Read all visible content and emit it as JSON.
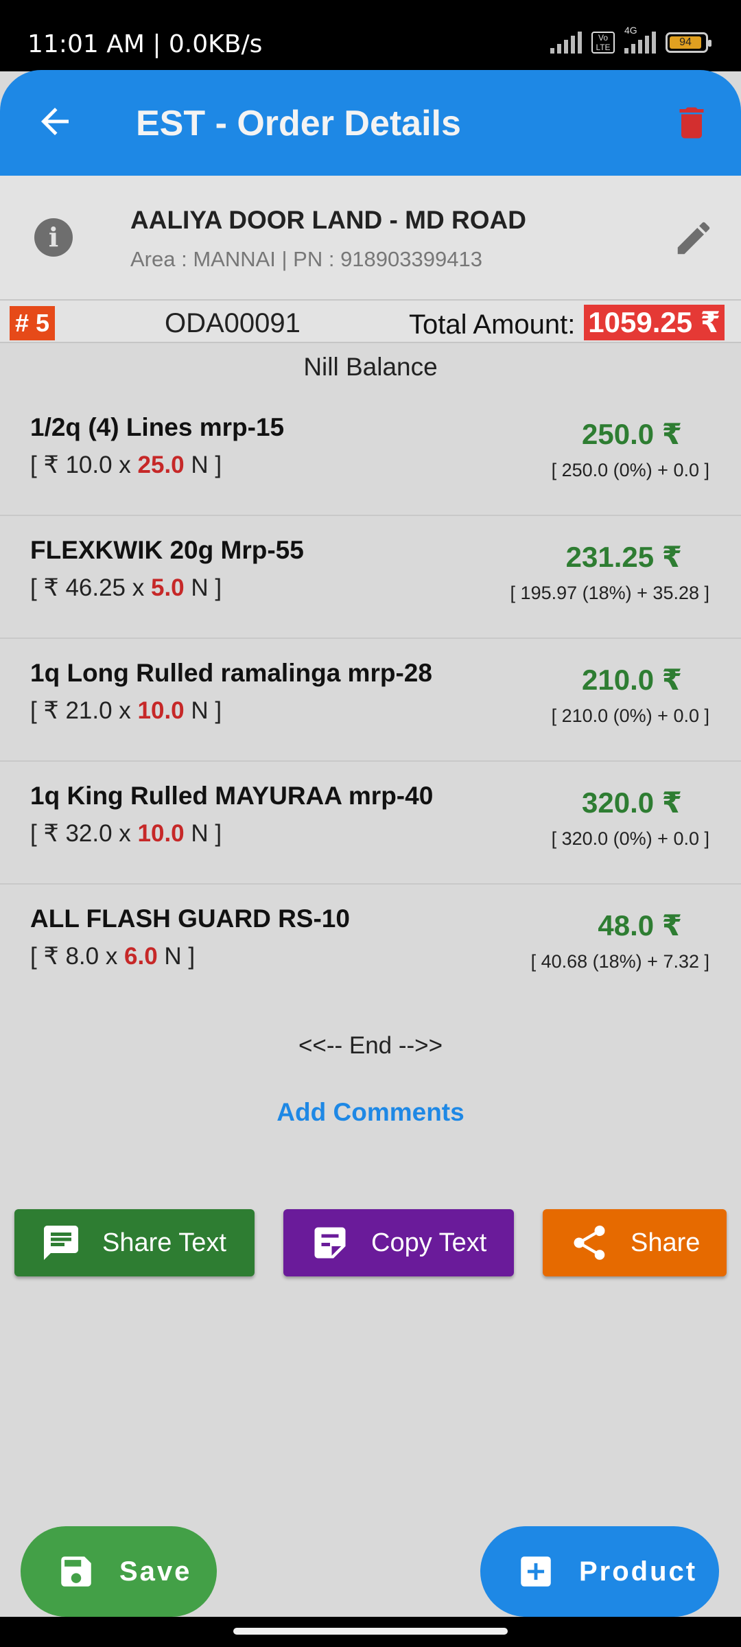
{
  "status_bar": {
    "time": "11:01 AM | 0.0KB/s",
    "network_label": "4G",
    "volte_label": "Vo LTE",
    "battery": "94"
  },
  "app_bar": {
    "title": "EST - Order Details",
    "back_icon": "arrow-left-icon",
    "delete_icon": "trash-icon",
    "color": "#1e88e5"
  },
  "customer": {
    "name": "AALIYA DOOR LAND - MD ROAD",
    "details": "Area : MANNAI | PN : 918903399413",
    "info_icon": "info-icon",
    "edit_icon": "pencil-icon"
  },
  "order": {
    "number": "# 5",
    "id": "ODA00091",
    "total_label": "Total Amount:",
    "total_value": "1059.25 ₹",
    "balance": "Nill Balance"
  },
  "items": [
    {
      "name": "1/2q (4) Lines mrp-15",
      "qty_prefix": "[ ₹ 10.0 x ",
      "qty": "25.0",
      "qty_suffix": " N ]",
      "amount": "250.0 ₹",
      "tax": "[ 250.0 (0%) + 0.0 ]"
    },
    {
      "name": "FLEXKWIK 20g Mrp-55",
      "qty_prefix": "[ ₹ 46.25 x ",
      "qty": "5.0",
      "qty_suffix": " N ]",
      "amount": "231.25 ₹",
      "tax": "[ 195.97 (18%) + 35.28 ]"
    },
    {
      "name": "1q Long Rulled ramalinga mrp-28",
      "qty_prefix": "[ ₹ 21.0 x ",
      "qty": "10.0",
      "qty_suffix": " N ]",
      "amount": "210.0 ₹",
      "tax": "[ 210.0 (0%) + 0.0 ]"
    },
    {
      "name": "1q King Rulled MAYURAA mrp-40",
      "qty_prefix": "[ ₹ 32.0 x ",
      "qty": "10.0",
      "qty_suffix": " N ]",
      "amount": "320.0 ₹",
      "tax": "[ 320.0 (0%) + 0.0 ]"
    },
    {
      "name": "ALL FLASH GUARD RS-10",
      "qty_prefix": "[ ₹ 8.0 x ",
      "qty": "6.0",
      "qty_suffix": " N ]",
      "amount": "48.0 ₹",
      "tax": "[ 40.68 (18%) + 7.32 ]"
    }
  ],
  "list_end": "<<-- End -->>",
  "add_comments": "Add Comments",
  "actions": {
    "share_text": {
      "label": "Share Text",
      "icon": "message-icon",
      "color": "#2e7d32"
    },
    "copy_text": {
      "label": "Copy Text",
      "icon": "note-icon",
      "color": "#6a1b9a"
    },
    "share": {
      "label": "Share",
      "icon": "share-icon",
      "color": "#e66a00"
    }
  },
  "fabs": {
    "save": {
      "label": "Save",
      "icon": "floppy-disk-icon",
      "color": "#43a047"
    },
    "product": {
      "label": "Product",
      "icon": "plus-box-icon",
      "color": "#1e88e5"
    }
  }
}
